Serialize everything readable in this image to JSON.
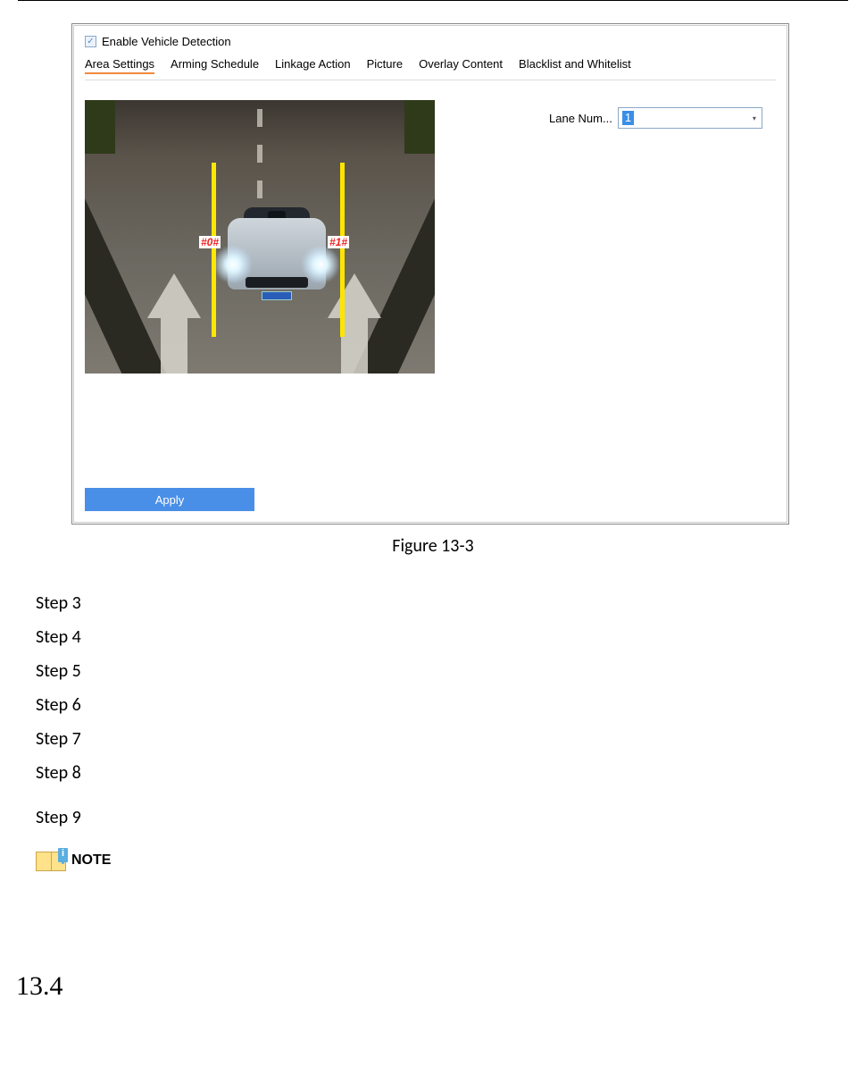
{
  "panel": {
    "enable_label": "Enable Vehicle Detection",
    "tabs": [
      "Area Settings",
      "Arming Schedule",
      "Linkage Action",
      "Picture",
      "Overlay Content",
      "Blacklist and Whitelist"
    ],
    "lane_field_label": "Lane Num...",
    "lane_field_value": "1",
    "preview": {
      "lane_labels": [
        "#0#",
        "#1#"
      ]
    },
    "apply_label": "Apply"
  },
  "caption": "Figure 13-3",
  "steps": [
    "Step 3",
    "Step 4",
    "Step 5",
    "Step 6",
    "Step 7",
    "Step 8",
    "Step 9"
  ],
  "note_label": "NOTE",
  "section_number": "13.4"
}
